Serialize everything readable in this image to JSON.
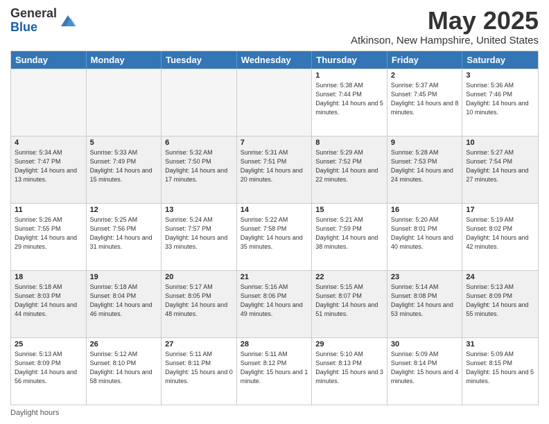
{
  "logo": {
    "text_general": "General",
    "text_blue": "Blue"
  },
  "header": {
    "month": "May 2025",
    "location": "Atkinson, New Hampshire, United States"
  },
  "days_of_week": [
    "Sunday",
    "Monday",
    "Tuesday",
    "Wednesday",
    "Thursday",
    "Friday",
    "Saturday"
  ],
  "weeks": [
    [
      {
        "day": "",
        "info": "",
        "empty": true
      },
      {
        "day": "",
        "info": "",
        "empty": true
      },
      {
        "day": "",
        "info": "",
        "empty": true
      },
      {
        "day": "",
        "info": "",
        "empty": true
      },
      {
        "day": "1",
        "info": "Sunrise: 5:38 AM\nSunset: 7:44 PM\nDaylight: 14 hours\nand 5 minutes."
      },
      {
        "day": "2",
        "info": "Sunrise: 5:37 AM\nSunset: 7:45 PM\nDaylight: 14 hours\nand 8 minutes."
      },
      {
        "day": "3",
        "info": "Sunrise: 5:36 AM\nSunset: 7:46 PM\nDaylight: 14 hours\nand 10 minutes."
      }
    ],
    [
      {
        "day": "4",
        "info": "Sunrise: 5:34 AM\nSunset: 7:47 PM\nDaylight: 14 hours\nand 13 minutes."
      },
      {
        "day": "5",
        "info": "Sunrise: 5:33 AM\nSunset: 7:49 PM\nDaylight: 14 hours\nand 15 minutes."
      },
      {
        "day": "6",
        "info": "Sunrise: 5:32 AM\nSunset: 7:50 PM\nDaylight: 14 hours\nand 17 minutes."
      },
      {
        "day": "7",
        "info": "Sunrise: 5:31 AM\nSunset: 7:51 PM\nDaylight: 14 hours\nand 20 minutes."
      },
      {
        "day": "8",
        "info": "Sunrise: 5:29 AM\nSunset: 7:52 PM\nDaylight: 14 hours\nand 22 minutes."
      },
      {
        "day": "9",
        "info": "Sunrise: 5:28 AM\nSunset: 7:53 PM\nDaylight: 14 hours\nand 24 minutes."
      },
      {
        "day": "10",
        "info": "Sunrise: 5:27 AM\nSunset: 7:54 PM\nDaylight: 14 hours\nand 27 minutes."
      }
    ],
    [
      {
        "day": "11",
        "info": "Sunrise: 5:26 AM\nSunset: 7:55 PM\nDaylight: 14 hours\nand 29 minutes."
      },
      {
        "day": "12",
        "info": "Sunrise: 5:25 AM\nSunset: 7:56 PM\nDaylight: 14 hours\nand 31 minutes."
      },
      {
        "day": "13",
        "info": "Sunrise: 5:24 AM\nSunset: 7:57 PM\nDaylight: 14 hours\nand 33 minutes."
      },
      {
        "day": "14",
        "info": "Sunrise: 5:22 AM\nSunset: 7:58 PM\nDaylight: 14 hours\nand 35 minutes."
      },
      {
        "day": "15",
        "info": "Sunrise: 5:21 AM\nSunset: 7:59 PM\nDaylight: 14 hours\nand 38 minutes."
      },
      {
        "day": "16",
        "info": "Sunrise: 5:20 AM\nSunset: 8:01 PM\nDaylight: 14 hours\nand 40 minutes."
      },
      {
        "day": "17",
        "info": "Sunrise: 5:19 AM\nSunset: 8:02 PM\nDaylight: 14 hours\nand 42 minutes."
      }
    ],
    [
      {
        "day": "18",
        "info": "Sunrise: 5:18 AM\nSunset: 8:03 PM\nDaylight: 14 hours\nand 44 minutes."
      },
      {
        "day": "19",
        "info": "Sunrise: 5:18 AM\nSunset: 8:04 PM\nDaylight: 14 hours\nand 46 minutes."
      },
      {
        "day": "20",
        "info": "Sunrise: 5:17 AM\nSunset: 8:05 PM\nDaylight: 14 hours\nand 48 minutes."
      },
      {
        "day": "21",
        "info": "Sunrise: 5:16 AM\nSunset: 8:06 PM\nDaylight: 14 hours\nand 49 minutes."
      },
      {
        "day": "22",
        "info": "Sunrise: 5:15 AM\nSunset: 8:07 PM\nDaylight: 14 hours\nand 51 minutes."
      },
      {
        "day": "23",
        "info": "Sunrise: 5:14 AM\nSunset: 8:08 PM\nDaylight: 14 hours\nand 53 minutes."
      },
      {
        "day": "24",
        "info": "Sunrise: 5:13 AM\nSunset: 8:09 PM\nDaylight: 14 hours\nand 55 minutes."
      }
    ],
    [
      {
        "day": "25",
        "info": "Sunrise: 5:13 AM\nSunset: 8:09 PM\nDaylight: 14 hours\nand 56 minutes."
      },
      {
        "day": "26",
        "info": "Sunrise: 5:12 AM\nSunset: 8:10 PM\nDaylight: 14 hours\nand 58 minutes."
      },
      {
        "day": "27",
        "info": "Sunrise: 5:11 AM\nSunset: 8:11 PM\nDaylight: 15 hours\nand 0 minutes."
      },
      {
        "day": "28",
        "info": "Sunrise: 5:11 AM\nSunset: 8:12 PM\nDaylight: 15 hours\nand 1 minute."
      },
      {
        "day": "29",
        "info": "Sunrise: 5:10 AM\nSunset: 8:13 PM\nDaylight: 15 hours\nand 3 minutes."
      },
      {
        "day": "30",
        "info": "Sunrise: 5:09 AM\nSunset: 8:14 PM\nDaylight: 15 hours\nand 4 minutes."
      },
      {
        "day": "31",
        "info": "Sunrise: 5:09 AM\nSunset: 8:15 PM\nDaylight: 15 hours\nand 5 minutes."
      }
    ]
  ],
  "footer": {
    "daylight_label": "Daylight hours"
  }
}
